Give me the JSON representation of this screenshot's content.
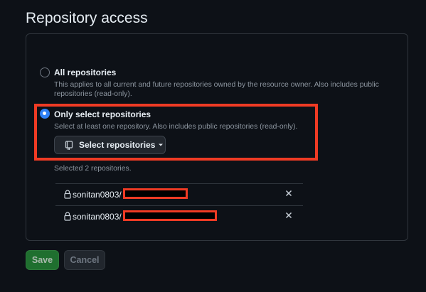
{
  "section_title": "Repository access",
  "options": [
    {
      "label": "All repositories",
      "description": "This applies to all current and future repositories owned by the resource owner. Also includes public repositories (read-only).",
      "selected": false
    },
    {
      "label": "Only select repositories",
      "description": "Select at least one repository. Also includes public repositories (read-only).",
      "selected": true
    }
  ],
  "select_button": {
    "label": "Select repositories",
    "icon": "repo-icon",
    "caret": "caret-down-icon"
  },
  "selected_summary": "Selected 2 repositories.",
  "repositories": [
    {
      "owner": "sonitan0803/",
      "name_redacted": true
    },
    {
      "owner": "sonitan0803/",
      "name_redacted": true
    }
  ],
  "actions": {
    "save_label": "Save",
    "cancel_label": "Cancel"
  },
  "colors": {
    "background": "#0d1117",
    "radio_selected": "#2f81f7",
    "annotation_red": "#ef3b24",
    "save_green": "#1f6f2f"
  }
}
